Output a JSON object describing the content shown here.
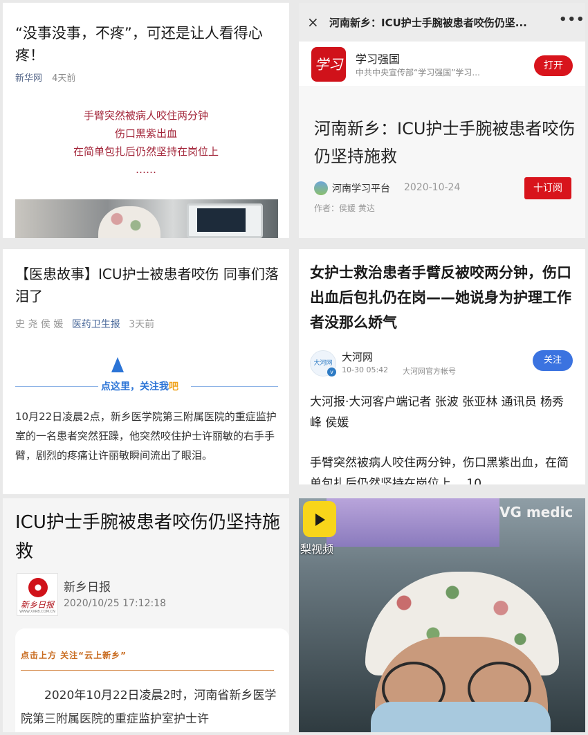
{
  "panel1": {
    "title": "“没事没事，不疼”，可还是让人看得心疼！",
    "source": "新华网",
    "time": "4天前",
    "quote_lines": [
      "手臂突然被病人咬住两分钟",
      "伤口黑紫出血",
      "在简单包扎后仍然坚持在岗位上",
      "……"
    ]
  },
  "panel2": {
    "bar_title": "河南新乡：ICU护士手腕被患者咬伤仍坚...",
    "close_icon": "×",
    "more_icon": "•••",
    "app_logo_text": "学习",
    "app_name": "学习强国",
    "app_desc": "中共中央宣传部“学习强国”学习...",
    "open_label": "打开",
    "title": "河南新乡：ICU护士手腕被患者咬伤仍坚持施救",
    "source": "河南学习平台",
    "date": "2020-10-24",
    "subscribe_label": "十订阅",
    "author": "作者：侯媛 黄达"
  },
  "panel3": {
    "title": "【医患故事】ICU护士被患者咬伤 同事们落泪了",
    "authors": "史 尧 侯 媛",
    "source": "医药卫生报",
    "time": "3天前",
    "follow_prompt": "点这里，关注我",
    "follow_prompt_tail": "吧",
    "body": "10月22日凌晨2点，新乡医学院第三附属医院的重症监护室的一名患者突然狂躁，他突然咬住护士许丽敏的右手手臂，剧烈的疼痛让许丽敏瞬间流出了眼泪。"
  },
  "panel4": {
    "title": "女护士救治患者手臂反被咬两分钟，伤口出血后包扎仍在岗——她说身为护理工作者没那么娇气",
    "avatar_text": "大河网",
    "verified_icon": "v",
    "account_name": "大河网",
    "time": "10-30 05:42",
    "account_type": "大河网官方帐号",
    "follow_label": "关注",
    "byline": "大河报·大河客户端记者 张波 张亚林 通讯员 杨秀峰 侯媛",
    "body": "手臂突然被病人咬住两分钟，伤口黑紫出血，在简单包扎后仍然坚持在岗位上。 10"
  },
  "panel5": {
    "title": "ICU护士手腕被患者咬伤仍坚持施救",
    "logo_brand": "新乡日报",
    "logo_url": "WWW.XXRB.COM.CN",
    "source": "新乡日报",
    "datetime": "2020/10/25 17:12:18",
    "follow_prompt": "点击上方 关注“云上新乡”",
    "body": "2020年10月22日凌晨2时，河南省新乡医学院第三附属医院的重症监护室护士许"
  },
  "panel6": {
    "app_name": "梨视频",
    "brand_text": "VG medic"
  }
}
